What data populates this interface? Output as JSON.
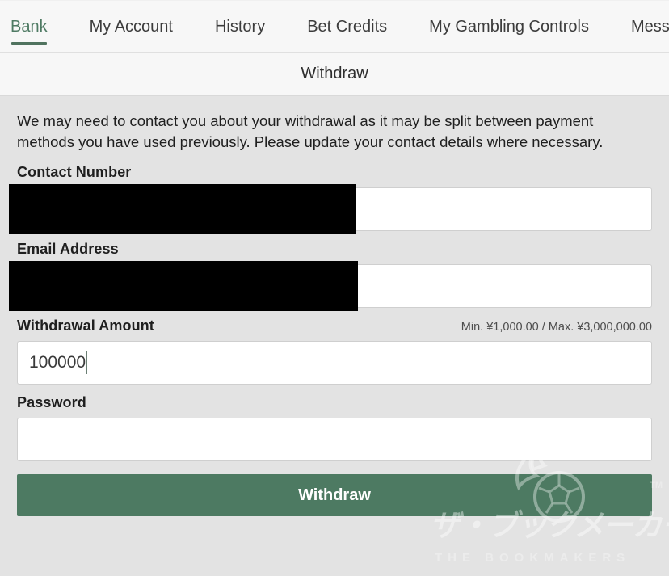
{
  "colors": {
    "accent_green": "#4d7a62",
    "active_tab_text": "#4e7a63",
    "page_background": "#e3e3e3",
    "header_background": "#f7f7f7",
    "input_background": "#ffffff",
    "input_border": "#cfcfcf",
    "redaction": "#000000",
    "body_text": "#1f1f1f"
  },
  "tabs": [
    {
      "label": "Bank",
      "active": true
    },
    {
      "label": "My Account",
      "active": false
    },
    {
      "label": "History",
      "active": false
    },
    {
      "label": "Bet Credits",
      "active": false
    },
    {
      "label": "My Gambling Controls",
      "active": false
    },
    {
      "label": "Messaging",
      "active": false
    }
  ],
  "section": {
    "title": "Withdraw"
  },
  "form": {
    "intro": "We may need to contact you about your withdrawal as it may be split between payment methods you have used previously. Please update your contact details where necessary.",
    "fields": [
      {
        "label": "Contact Number",
        "hint": "",
        "value": "",
        "placeholder": "",
        "redacted": true,
        "type": "tel"
      },
      {
        "label": "Email Address",
        "hint": "",
        "value": "",
        "placeholder": "",
        "redacted": true,
        "type": "email"
      },
      {
        "label": "Withdrawal Amount",
        "hint": "Min. ¥1,000.00 / Max. ¥3,000,000.00",
        "value": "100000",
        "placeholder": "",
        "redacted": false,
        "type": "text",
        "focused": true
      },
      {
        "label": "Password",
        "hint": "",
        "value": "",
        "placeholder": "",
        "redacted": false,
        "type": "password"
      }
    ],
    "submit_label": "Withdraw"
  },
  "watermark": {
    "japanese": "ザ・ブックメーカース",
    "english": "THE BOOKMAKERS",
    "trademark": "TM",
    "logo_icon": "flaming-soccer-ball-icon"
  }
}
